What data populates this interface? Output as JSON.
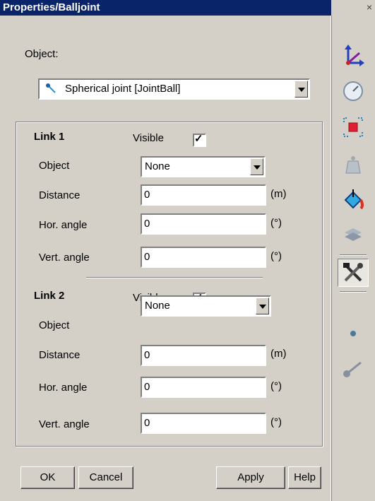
{
  "window": {
    "title": "Properties/Balljoint",
    "close_glyph": "×"
  },
  "object": {
    "label": "Object:",
    "value": "Spherical joint  [JointBall]",
    "icon": "joint-ball-icon"
  },
  "links": [
    {
      "title": "Link 1",
      "visible_label": "Visible",
      "visible_checked": true,
      "check_glyph": "✓",
      "object_label": "Object",
      "object_value": "None",
      "distance_label": "Distance",
      "distance_value": "0",
      "distance_unit": "(m)",
      "hor_label": "Hor. angle",
      "hor_value": "0",
      "hor_unit": "(°)",
      "vert_label": "Vert. angle",
      "vert_value": "0",
      "vert_unit": "(°)"
    },
    {
      "title": "Link 2",
      "visible_label": "Visible",
      "visible_checked": true,
      "check_glyph": "✓",
      "object_label": "Object",
      "object_value": "None",
      "distance_label": "Distance",
      "distance_value": "0",
      "distance_unit": "(m)",
      "hor_label": "Hor. angle",
      "hor_value": "0",
      "hor_unit": "(°)",
      "vert_label": "Vert. angle",
      "vert_value": "0",
      "vert_unit": "(°)"
    }
  ],
  "buttons": {
    "ok": "OK",
    "cancel": "Cancel",
    "apply": "Apply",
    "help": "Help"
  },
  "toolbar": {
    "items": [
      "axes-icon",
      "gauge-icon",
      "bounding-box-icon",
      "weight-icon",
      "paint-bucket-icon",
      "layers-icon",
      "tools-icon",
      "joint-ball-icon",
      "link-icon"
    ],
    "active": "tools-icon"
  },
  "colors": {
    "title_bar": "#0a246a",
    "dialog_face": "#d4d0c8",
    "field_bg": "#ffffff"
  }
}
